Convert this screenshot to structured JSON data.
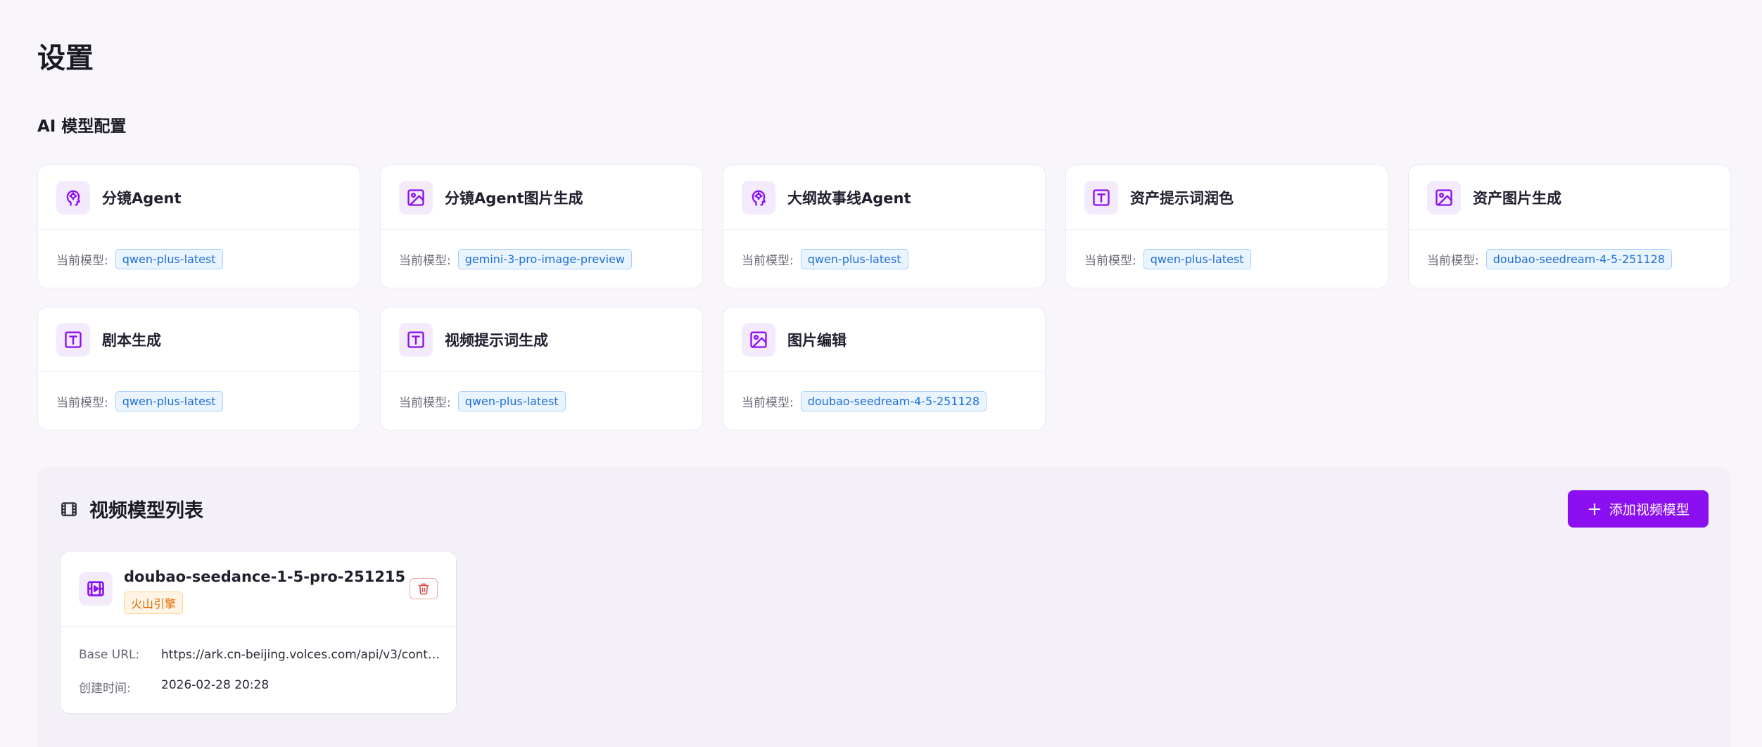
{
  "page": {
    "title": "设置"
  },
  "ai_section": {
    "title": "AI 模型配置"
  },
  "model_label": "当前模型:",
  "cards": [
    {
      "name": "分镜Agent",
      "icon": "brain-icon",
      "model": "qwen-plus-latest"
    },
    {
      "name": "分镜Agent图片生成",
      "icon": "image-icon",
      "model": "gemini-3-pro-image-preview"
    },
    {
      "name": "大纲故事线Agent",
      "icon": "brain-icon",
      "model": "qwen-plus-latest"
    },
    {
      "name": "资产提示词润色",
      "icon": "text-icon",
      "model": "qwen-plus-latest"
    },
    {
      "name": "资产图片生成",
      "icon": "image-icon",
      "model": "doubao-seedream-4-5-251128"
    },
    {
      "name": "剧本生成",
      "icon": "text-icon",
      "model": "qwen-plus-latest"
    },
    {
      "name": "视频提示词生成",
      "icon": "text-icon",
      "model": "qwen-plus-latest"
    },
    {
      "name": "图片编辑",
      "icon": "image-icon",
      "model": "doubao-seedream-4-5-251128"
    }
  ],
  "video_section": {
    "title": "视频模型列表",
    "add_button": "添加视频模型",
    "models": [
      {
        "name": "doubao-seedance-1-5-pro-251215",
        "provider": "火山引擎",
        "base_url_label": "Base URL:",
        "base_url": "https://ark.cn-beijing.volces.com/api/v3/conten...",
        "created_label": "创建时间:",
        "created": "2026-02-28 20:28"
      }
    ]
  },
  "colors": {
    "accent": "#8b0ff0",
    "icon_bg": "#f3ebfc",
    "tag_blue": "#1d6fd6",
    "badge_orange": "#e06a00",
    "delete_red": "#e04848"
  }
}
